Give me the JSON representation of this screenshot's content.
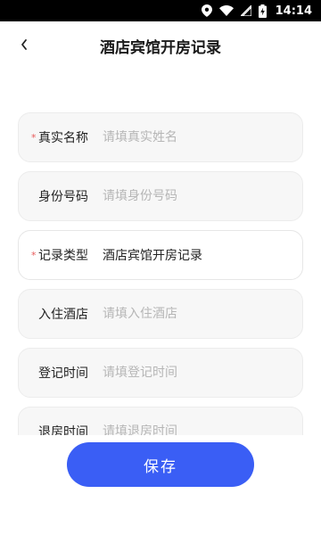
{
  "status_bar": {
    "time": "14:14",
    "icons": [
      "location-icon",
      "wifi-icon",
      "signal-icon",
      "battery-charging-icon"
    ]
  },
  "header": {
    "title": "酒店宾馆开房记录",
    "back_icon": "chevron-left-icon"
  },
  "form": {
    "fields": [
      {
        "label": "真实名称",
        "placeholder": "请填真实姓名",
        "required": true
      },
      {
        "label": "身份号码",
        "placeholder": "请填身份号码",
        "required": false
      },
      {
        "label": "记录类型",
        "value": "酒店宾馆开房记录",
        "required": true
      },
      {
        "label": "入住酒店",
        "placeholder": "请填入住酒店",
        "required": false
      },
      {
        "label": "登记时间",
        "placeholder": "请填登记时间",
        "required": false
      },
      {
        "label": "退房时间",
        "placeholder": "请填退房时间",
        "required": false
      }
    ],
    "required_mark": "*"
  },
  "save_button": {
    "label": "保存",
    "color": "#3a5ef5"
  }
}
